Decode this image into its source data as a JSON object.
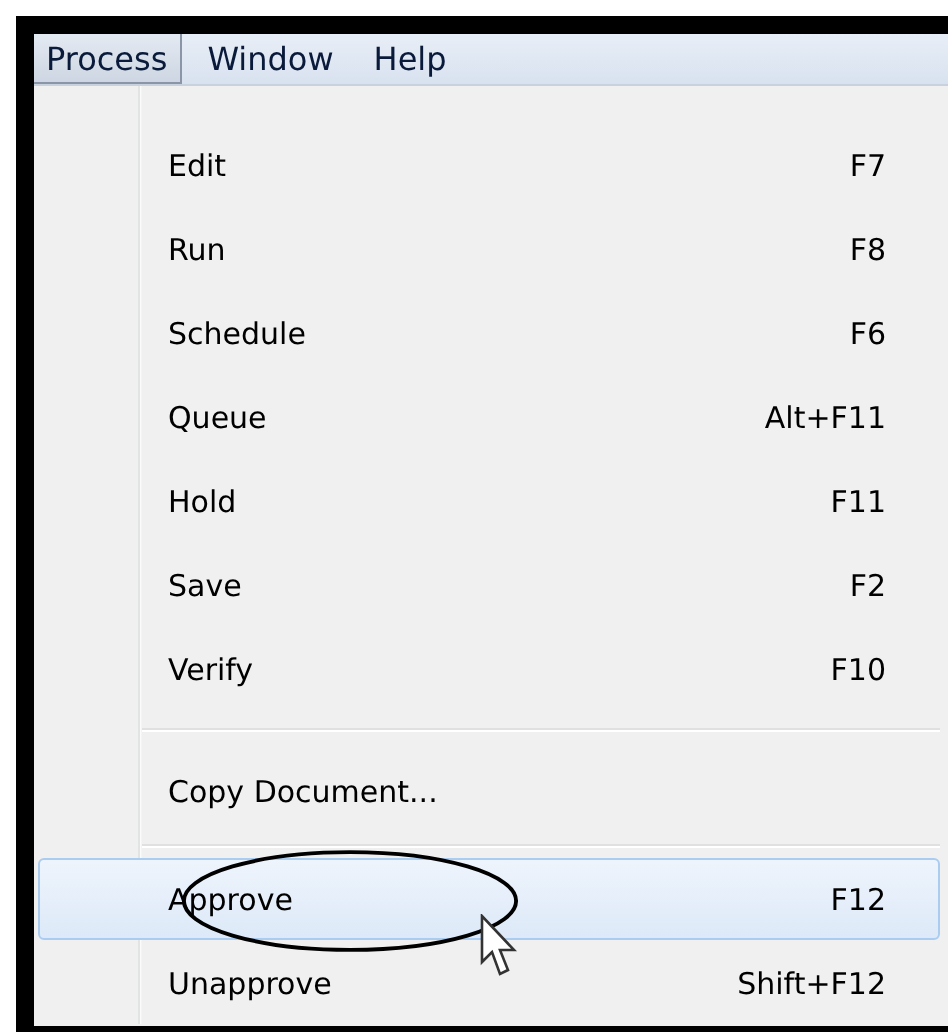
{
  "menu_bar": [
    {
      "label": "Process",
      "selected": true
    },
    {
      "label": "Window",
      "selected": false
    },
    {
      "label": "Help",
      "selected": false
    }
  ],
  "menu": [
    {
      "kind": "item",
      "label": "Edit",
      "shortcut": "F7",
      "selected": false
    },
    {
      "kind": "item",
      "label": "Run",
      "shortcut": "F8",
      "selected": false
    },
    {
      "kind": "item",
      "label": "Schedule",
      "shortcut": "F6",
      "selected": false
    },
    {
      "kind": "item",
      "label": "Queue",
      "shortcut": "Alt+F11",
      "selected": false
    },
    {
      "kind": "item",
      "label": "Hold",
      "shortcut": "F11",
      "selected": false
    },
    {
      "kind": "item",
      "label": "Save",
      "shortcut": "F2",
      "selected": false
    },
    {
      "kind": "item",
      "label": "Verify",
      "shortcut": "F10",
      "selected": false
    },
    {
      "kind": "separator"
    },
    {
      "kind": "item",
      "label": "Copy Document...",
      "selected": false
    },
    {
      "kind": "separator"
    },
    {
      "kind": "item",
      "label": "Approve",
      "shortcut": "F12",
      "selected": true
    },
    {
      "kind": "item",
      "label": "Unapprove",
      "shortcut": "Shift+F12",
      "selected": false
    }
  ]
}
